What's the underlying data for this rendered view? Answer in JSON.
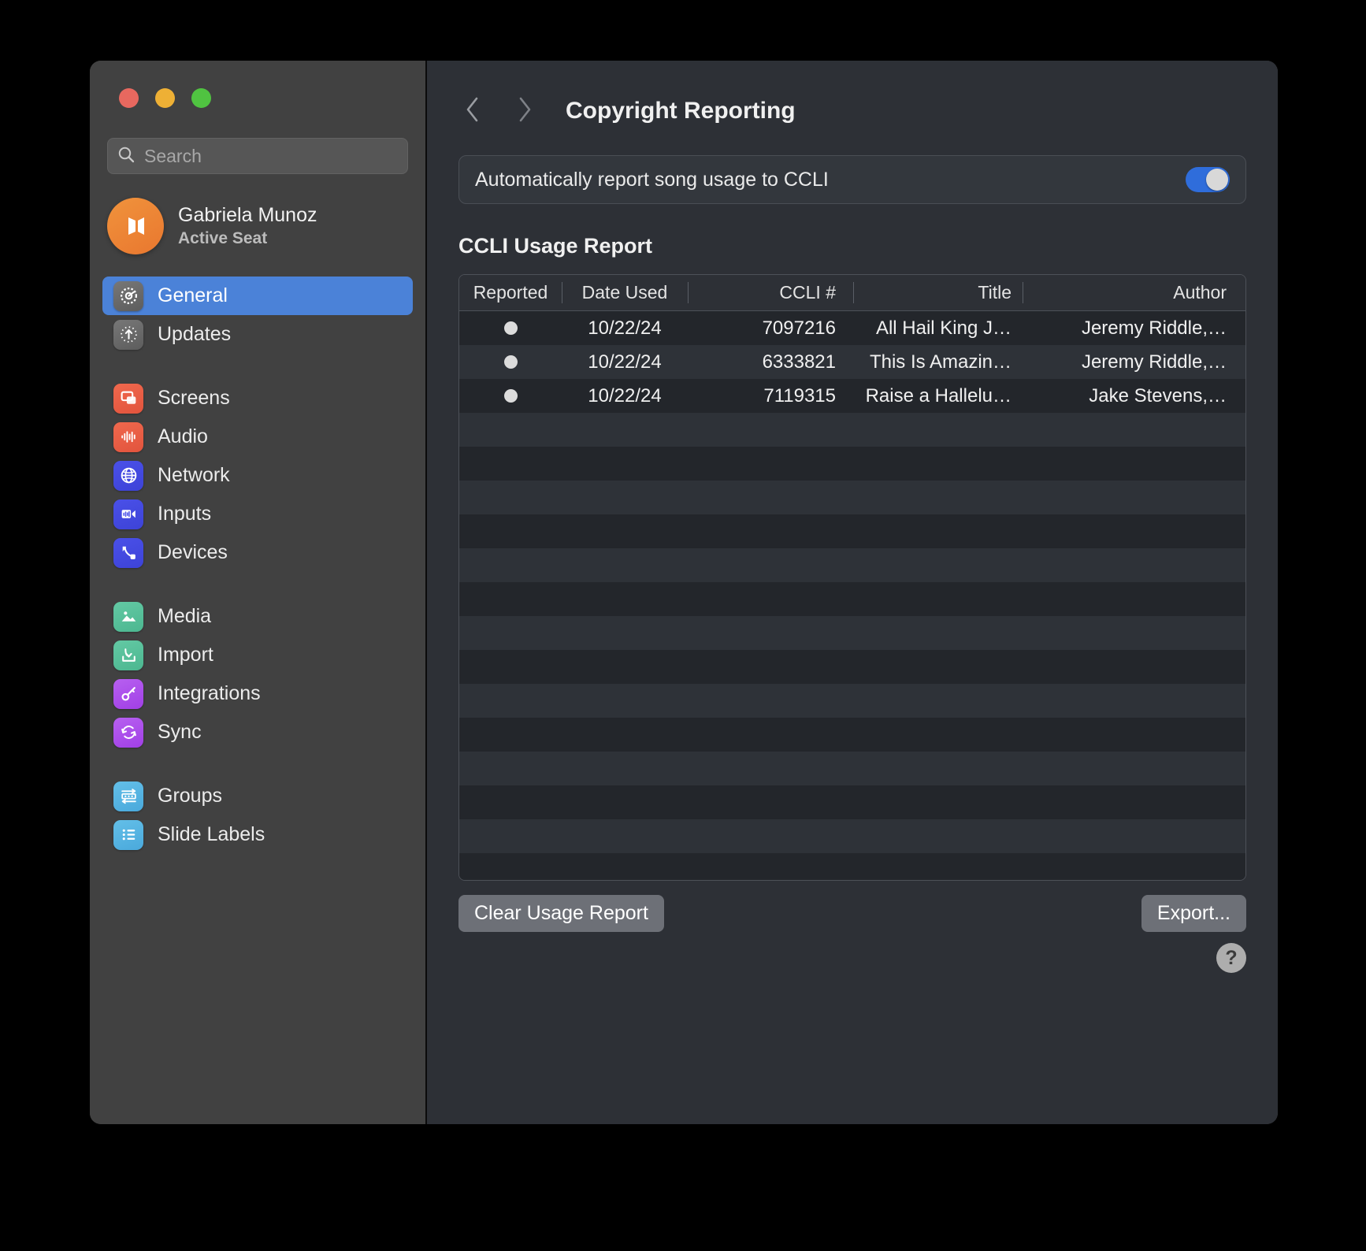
{
  "window": {
    "traffic_lights": [
      "close",
      "minimize",
      "zoom"
    ],
    "colors": {
      "accent": "#4b82d8",
      "toggle_on": "#2f6ddb",
      "avatar": "#e9772f",
      "sidebar_bg": "#414141",
      "main_bg": "#2d3036"
    }
  },
  "sidebar": {
    "search": {
      "placeholder": "Search",
      "value": "",
      "icon": "search-icon"
    },
    "account": {
      "name": "Gabriela Munoz",
      "status": "Active Seat",
      "avatar_icon": "propresenter-logo-icon"
    },
    "groups": [
      {
        "items": [
          {
            "label": "General",
            "icon": "gear-icon",
            "color": "gray",
            "active": true
          },
          {
            "label": "Updates",
            "icon": "update-arrow-icon",
            "color": "gray",
            "active": false
          }
        ]
      },
      {
        "items": [
          {
            "label": "Screens",
            "icon": "screens-icon",
            "color": "red",
            "active": false
          },
          {
            "label": "Audio",
            "icon": "waveform-icon",
            "color": "red",
            "active": false
          },
          {
            "label": "Network",
            "icon": "globe-icon",
            "color": "blue",
            "active": false
          },
          {
            "label": "Inputs",
            "icon": "input-meter-icon",
            "color": "blue",
            "active": false
          },
          {
            "label": "Devices",
            "icon": "devices-link-icon",
            "color": "blue",
            "active": false
          }
        ]
      },
      {
        "items": [
          {
            "label": "Media",
            "icon": "photo-icon",
            "color": "green",
            "active": false
          },
          {
            "label": "Import",
            "icon": "import-icon",
            "color": "green",
            "active": false
          },
          {
            "label": "Integrations",
            "icon": "key-icon",
            "color": "purple",
            "active": false
          },
          {
            "label": "Sync",
            "icon": "sync-icon",
            "color": "purple",
            "active": false
          }
        ]
      },
      {
        "items": [
          {
            "label": "Groups",
            "icon": "groups-icon",
            "color": "cyan",
            "active": false
          },
          {
            "label": "Slide Labels",
            "icon": "slide-labels-icon",
            "color": "cyan",
            "active": false
          }
        ]
      }
    ]
  },
  "main": {
    "back_icon": "chevron-left-icon",
    "forward_icon": "chevron-right-icon",
    "title": "Copyright Reporting",
    "auto_report": {
      "label": "Automatically report song usage to CCLI",
      "enabled": true
    },
    "section_title": "CCLI Usage Report",
    "table": {
      "columns": [
        "Reported",
        "Date Used",
        "CCLI #",
        "Title",
        "Author"
      ],
      "rows": [
        {
          "reported": "●",
          "date": "10/22/24",
          "ccli": "7097216",
          "title": "All Hail King J…",
          "author": "Jeremy Riddle,…"
        },
        {
          "reported": "●",
          "date": "10/22/24",
          "ccli": "6333821",
          "title": "This Is Amazin…",
          "author": "Jeremy Riddle,…"
        },
        {
          "reported": "●",
          "date": "10/22/24",
          "ccli": "7119315",
          "title": "Raise a Hallelu…",
          "author": "Jake Stevens,…"
        }
      ],
      "empty_row_count": 15
    },
    "buttons": {
      "clear": "Clear Usage Report",
      "export": "Export...",
      "help": "?"
    }
  }
}
